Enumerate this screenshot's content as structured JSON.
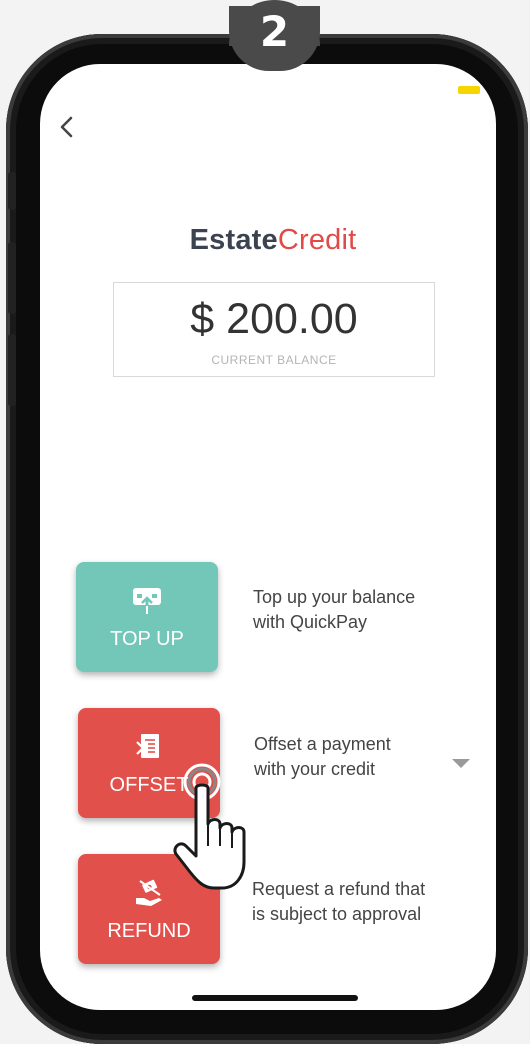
{
  "tutorial": {
    "step_number": "2"
  },
  "icons": {
    "back": "chevron-left-icon",
    "top_up": "card-upload-icon",
    "offset": "invoice-icon",
    "refund": "hand-refund-icon",
    "dropdown": "caret-down-icon",
    "pointer": "hand-pointer-icon"
  },
  "colors": {
    "brand_dark": "#3b4350",
    "brand_red": "#e24a47",
    "teal": "#72c7b9",
    "red": "#e2504b",
    "status_yellow": "#f6d500"
  },
  "header": {
    "brand_first": "Estate",
    "brand_second": "Credit"
  },
  "balance": {
    "amount": "$ 200.00",
    "caption": "CURRENT BALANCE"
  },
  "actions": [
    {
      "label": "TOP UP",
      "line1": "Top up your balance",
      "line2": "with QuickPay"
    },
    {
      "label": "OFFSET",
      "line1": "Offset a payment",
      "line2": "with your credit"
    },
    {
      "label": "REFUND",
      "line1": "Request a refund that",
      "line2": "is subject to approval"
    }
  ]
}
